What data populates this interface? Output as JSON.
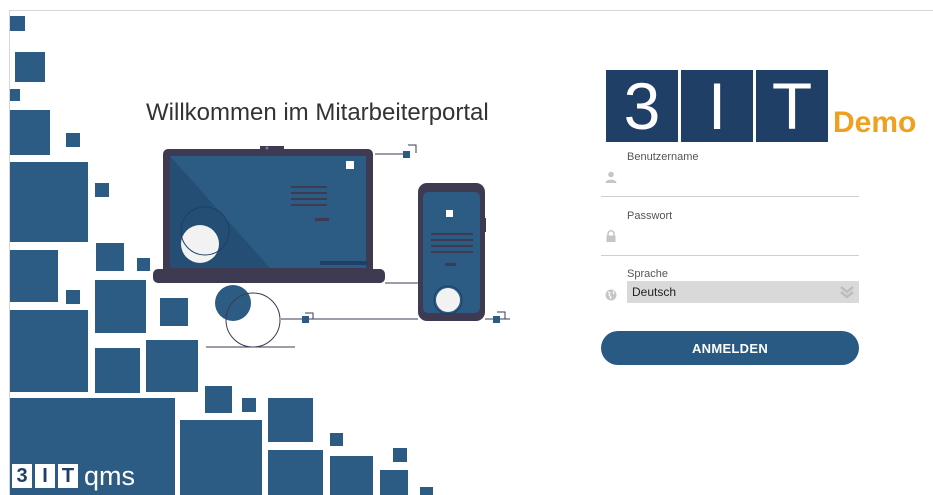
{
  "welcome": {
    "title": "Willkommen im Mitarbeiterportal"
  },
  "brand": {
    "letter_1": "3",
    "letter_2": "I",
    "letter_3": "T",
    "suffix": "qms"
  },
  "logo": {
    "letter_1": "3",
    "letter_2": "I",
    "letter_3": "T",
    "badge": "Demo"
  },
  "form": {
    "username": {
      "label": "Benutzername",
      "value": ""
    },
    "password": {
      "label": "Passwort",
      "value": ""
    },
    "language": {
      "label": "Sprache",
      "selected": "Deutsch"
    },
    "submit_label": "ANMELDEN"
  },
  "colors": {
    "primary": "#2c5b83",
    "logo_blue": "#1f3f66",
    "demo_accent": "#f0a020",
    "select_bg": "#d9d9d9"
  },
  "icons": [
    "user-icon",
    "lock-icon",
    "globe-icon",
    "chevron-down-icon"
  ]
}
